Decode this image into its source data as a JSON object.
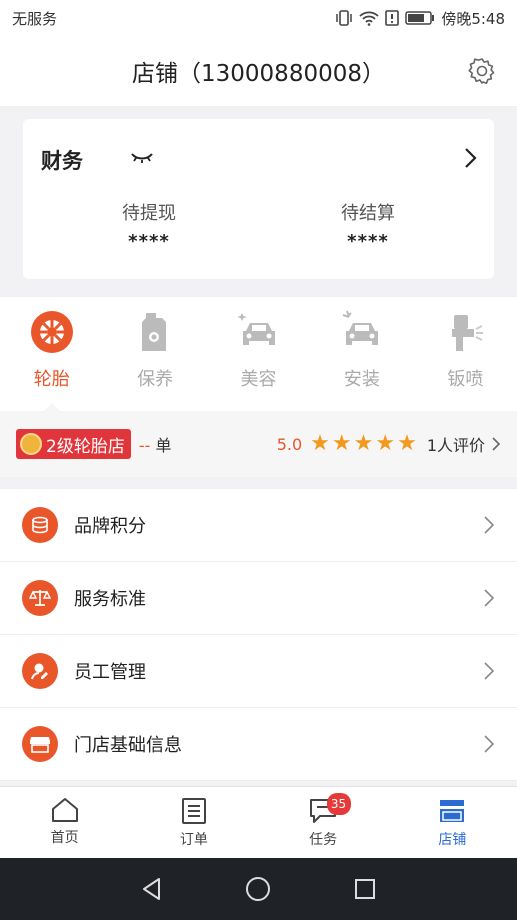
{
  "status_bar": {
    "carrier": "无服务",
    "time": "傍晚5:48"
  },
  "header": {
    "title": "店铺（13000880008）"
  },
  "finance": {
    "title": "财务",
    "items": [
      {
        "label": "待提现",
        "value": "****"
      },
      {
        "label": "待结算",
        "value": "****"
      }
    ]
  },
  "categories": [
    {
      "label": "轮胎",
      "icon": "tire-icon",
      "active": true
    },
    {
      "label": "保养",
      "icon": "oil-can-icon",
      "active": false
    },
    {
      "label": "美容",
      "icon": "car-sparkle-icon",
      "active": false
    },
    {
      "label": "安装",
      "icon": "car-install-icon",
      "active": false
    },
    {
      "label": "钣喷",
      "icon": "spray-gun-icon",
      "active": false
    }
  ],
  "level": {
    "badge": "2级轮胎店",
    "orders_count": "--",
    "orders_unit": "单",
    "score": "5.0",
    "stars": 5,
    "reviews": "1人评价"
  },
  "menu": [
    {
      "label": "品牌积分",
      "icon": "coins-icon"
    },
    {
      "label": "服务标准",
      "icon": "scale-icon"
    },
    {
      "label": "员工管理",
      "icon": "staff-icon"
    },
    {
      "label": "门店基础信息",
      "icon": "storefront-icon"
    }
  ],
  "tabs": [
    {
      "label": "首页",
      "icon": "home-icon"
    },
    {
      "label": "订单",
      "icon": "order-icon"
    },
    {
      "label": "任务",
      "icon": "task-icon",
      "badge": "35"
    },
    {
      "label": "店铺",
      "icon": "shop-icon"
    }
  ],
  "colors": {
    "accent": "#e8562a",
    "tab_active": "#2b6cd4",
    "badge_red": "#e0363b",
    "star": "#f29a1f"
  }
}
